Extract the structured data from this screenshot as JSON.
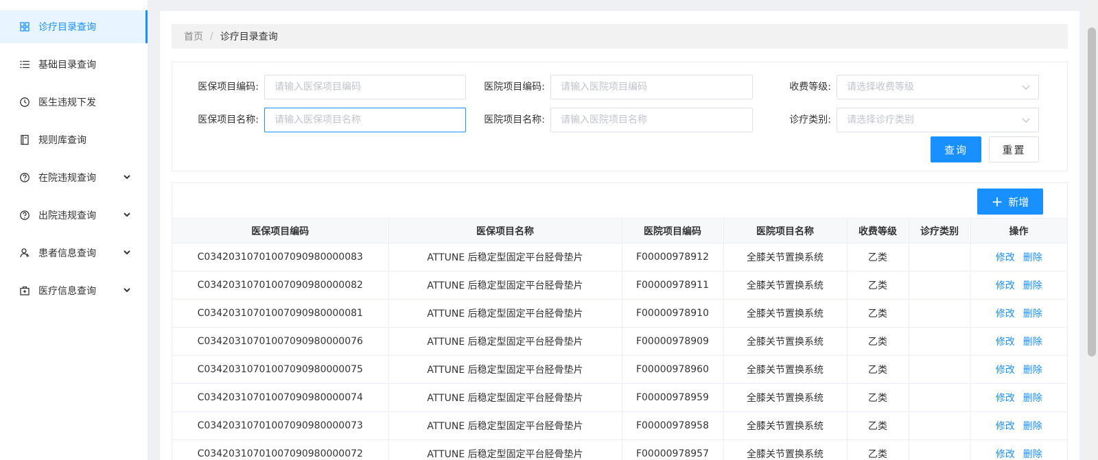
{
  "sidebar": {
    "items": [
      {
        "label": "诊疗目录查询",
        "icon": "grid-icon",
        "active": true,
        "expandable": false
      },
      {
        "label": "基础目录查询",
        "icon": "list-icon",
        "active": false,
        "expandable": false
      },
      {
        "label": "医生违规下发",
        "icon": "clock-icon",
        "active": false,
        "expandable": false
      },
      {
        "label": "规则库查询",
        "icon": "book-icon",
        "active": false,
        "expandable": false
      },
      {
        "label": "在院违规查询",
        "icon": "question-icon",
        "active": false,
        "expandable": true
      },
      {
        "label": "出院违规查询",
        "icon": "question-icon",
        "active": false,
        "expandable": true
      },
      {
        "label": "患者信息查询",
        "icon": "person-icon",
        "active": false,
        "expandable": true
      },
      {
        "label": "医疗信息查询",
        "icon": "medical-bag-icon",
        "active": false,
        "expandable": true
      }
    ]
  },
  "breadcrumb": {
    "home": "首页",
    "separator": "/",
    "current": "诊疗目录查询"
  },
  "filters": {
    "ins_code": {
      "label": "医保项目编码:",
      "placeholder": "请输入医保项目编码",
      "value": ""
    },
    "hosp_code": {
      "label": "医院项目编码:",
      "placeholder": "请输入医院项目编码",
      "value": ""
    },
    "fee_level": {
      "label": "收费等级:",
      "placeholder": "请选择收费等级"
    },
    "ins_name": {
      "label": "医保项目名称:",
      "placeholder": "请输入医保项目名称",
      "value": ""
    },
    "hosp_name": {
      "label": "医院项目名称:",
      "placeholder": "请输入医院项目名称",
      "value": ""
    },
    "category": {
      "label": "诊疗类别:",
      "placeholder": "请选择诊疗类别"
    },
    "query_label": "查询",
    "reset_label": "重置"
  },
  "table": {
    "add_label": "新增",
    "columns": [
      "医保项目编码",
      "医保项目名称",
      "医院项目编码",
      "医院项目名称",
      "收费等级",
      "诊疗类别",
      "操作"
    ],
    "edit_label": "修改",
    "delete_label": "删除",
    "rows": [
      {
        "ins_code": "C03420310701007090980000083",
        "ins_name": "ATTUNE 后稳定型固定平台胫骨垫片",
        "hosp_code": "F00000978912",
        "hosp_name": "全膝关节置换系统",
        "level": "乙类",
        "category": ""
      },
      {
        "ins_code": "C03420310701007090980000082",
        "ins_name": "ATTUNE 后稳定型固定平台胫骨垫片",
        "hosp_code": "F00000978911",
        "hosp_name": "全膝关节置换系统",
        "level": "乙类",
        "category": ""
      },
      {
        "ins_code": "C03420310701007090980000081",
        "ins_name": "ATTUNE 后稳定型固定平台胫骨垫片",
        "hosp_code": "F00000978910",
        "hosp_name": "全膝关节置换系统",
        "level": "乙类",
        "category": ""
      },
      {
        "ins_code": "C03420310701007090980000076",
        "ins_name": "ATTUNE 后稳定型固定平台胫骨垫片",
        "hosp_code": "F00000978909",
        "hosp_name": "全膝关节置换系统",
        "level": "乙类",
        "category": ""
      },
      {
        "ins_code": "C03420310701007090980000075",
        "ins_name": "ATTUNE 后稳定型固定平台胫骨垫片",
        "hosp_code": "F00000978960",
        "hosp_name": "全膝关节置换系统",
        "level": "乙类",
        "category": ""
      },
      {
        "ins_code": "C03420310701007090980000074",
        "ins_name": "ATTUNE 后稳定型固定平台胫骨垫片",
        "hosp_code": "F00000978959",
        "hosp_name": "全膝关节置换系统",
        "level": "乙类",
        "category": ""
      },
      {
        "ins_code": "C03420310701007090980000073",
        "ins_name": "ATTUNE 后稳定型固定平台胫骨垫片",
        "hosp_code": "F00000978958",
        "hosp_name": "全膝关节置换系统",
        "level": "乙类",
        "category": ""
      },
      {
        "ins_code": "C03420310701007090980000072",
        "ins_name": "ATTUNE 后稳定型固定平台胫骨垫片",
        "hosp_code": "F00000978957",
        "hosp_name": "全膝关节置换系统",
        "level": "乙类",
        "category": ""
      }
    ]
  },
  "colors": {
    "primary": "#1890ff",
    "active_bg": "#e8f4ff",
    "header_bg": "#f7f8fa"
  }
}
